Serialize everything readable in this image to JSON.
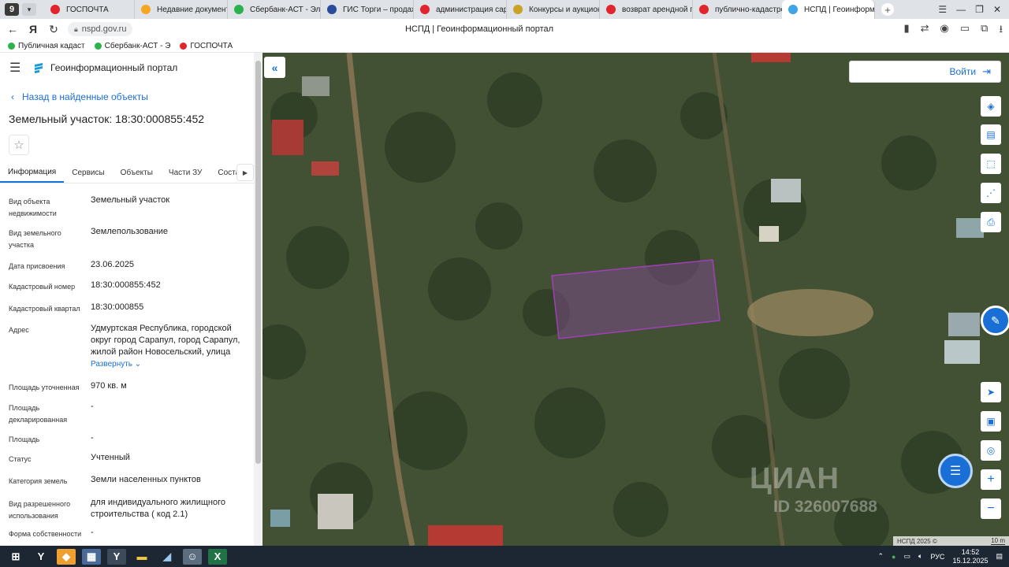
{
  "browser": {
    "tab_count": "9",
    "tabs": [
      {
        "label": "ГОСПОЧТА",
        "color": "#e2252c"
      },
      {
        "label": "Недавние документы",
        "color": "#f5a623"
      },
      {
        "label": "Сбербанк-АСТ - Элект",
        "color": "#2bb24c"
      },
      {
        "label": "ГИС Торги – продажа",
        "color": "#2a4b9b"
      },
      {
        "label": "администрация сарап",
        "color": "#e2252c"
      },
      {
        "label": "Конкурсы и аукционы",
        "color": "#c9a227"
      },
      {
        "label": "возврат арендной пл",
        "color": "#e2252c"
      },
      {
        "label": "публично-кадастров",
        "color": "#e2252c"
      }
    ],
    "active_tab": "НСПД | Геоинформ",
    "url": "nspd.gov.ru",
    "page_title": "НСПД | Геоинформационный портал",
    "bookmarks": [
      {
        "label": "Публичная кадаст",
        "color": "#2bb24c"
      },
      {
        "label": "Сбербанк-АСТ - Э",
        "color": "#2bb24c"
      },
      {
        "label": "ГОСПОЧТА",
        "color": "#e2252c"
      }
    ]
  },
  "panel": {
    "portal_name": "Геоинформационный портал",
    "back_label": "Назад в найденные объекты",
    "title": "Земельный участок: 18:30:000855:452",
    "tabs": [
      "Информация",
      "Сервисы",
      "Объекты",
      "Части ЗУ",
      "Соста"
    ],
    "properties": [
      {
        "label": "Вид объекта недвижимости",
        "value": "Земельный участок"
      },
      {
        "label": "Вид земельного участка",
        "value": "Землепользование"
      },
      {
        "label": "Дата присвоения",
        "value": "23.06.2025"
      },
      {
        "label": "Кадастровый номер",
        "value": "18:30:000855:452"
      },
      {
        "label": "Кадастровый квартал",
        "value": "18:30:000855"
      },
      {
        "label": "Адрес",
        "value": "Удмуртская Республика, городской округ город Сарапул, город Сарапул, жилой район Новосельский, улица"
      },
      {
        "label": "Площадь уточненная",
        "value": "970 кв. м"
      },
      {
        "label": "Площадь декларированная",
        "value": "-"
      },
      {
        "label": "Площадь",
        "value": "-"
      },
      {
        "label": "Статус",
        "value": "Учтенный"
      },
      {
        "label": "Категория земель",
        "value": "Земли населенных пунктов"
      },
      {
        "label": "Вид разрешенного использования",
        "value": "для индивидуального жилищного строительства ( код 2.1)"
      },
      {
        "label": "Форма собственности",
        "value": "-"
      }
    ],
    "expand_label": "Развернуть"
  },
  "map": {
    "login_label": "Войти",
    "watermark": "ЦИАН",
    "watermark_id": "ID 326007688",
    "copyright": "НСПД 2025 ©",
    "scale": "10 m"
  },
  "taskbar": {
    "lang": "РУС",
    "time": "14:52",
    "date": "15.12.2025"
  }
}
